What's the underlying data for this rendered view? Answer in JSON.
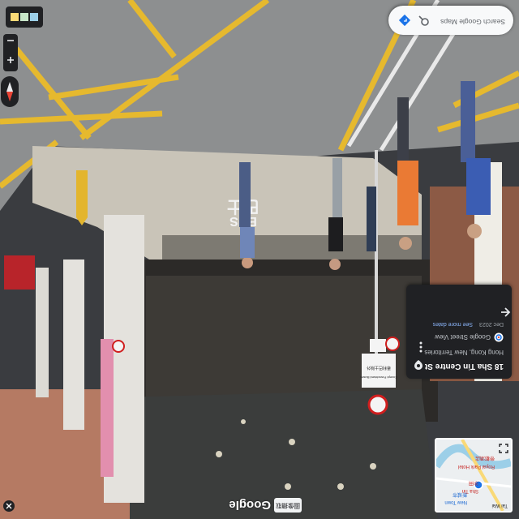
{
  "app": {
    "logo": "Google",
    "badge": "圖像擷取"
  },
  "info_card": {
    "title": "18 Sha Tin Centre St",
    "subtitle": "Hong Kong, New Territories",
    "brand": "Google Street View",
    "date": "Dec 2023",
    "more_link": "See more dates"
  },
  "search": {
    "placeholder": "Search Google Maps"
  },
  "minimap": {
    "labels": [
      "Royal Park Hotel",
      "帝都酒店",
      "Sha Tin",
      "沙田",
      "New Town",
      "新城市",
      "Tai Wai"
    ]
  },
  "scene_text": {
    "exit_sign": "Except Franchised Buses",
    "exit_sign_cn": "專利巴士除外",
    "road_marking": "BUS",
    "road_marking_cn": "巴士"
  },
  "colors": {
    "card_bg": "#202124",
    "link": "#8ab4f8",
    "road_yellow": "#e6b92e"
  },
  "icons": {
    "compass": "compass-icon",
    "zoom_in": "plus-icon",
    "zoom_out": "minus-icon",
    "close": "close-icon",
    "back": "arrow-back-icon",
    "fullscreen": "fullscreen-icon",
    "search": "search-icon",
    "directions": "directions-icon",
    "layers": "layers-icon",
    "pin": "pin-icon"
  }
}
